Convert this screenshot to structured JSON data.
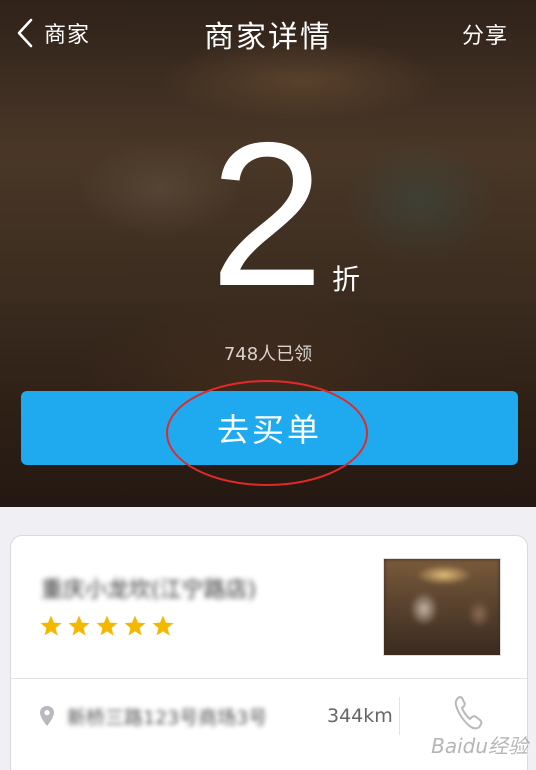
{
  "nav": {
    "back_label": "商家",
    "title": "商家详情",
    "share_label": "分享"
  },
  "offer": {
    "discount_value": "2",
    "discount_unit": "折",
    "claimed_text": "748人已领",
    "pay_button_label": "去买单"
  },
  "merchant": {
    "name": "重庆小龙坎(江宁路店)",
    "rating_stars": 5,
    "address": "新桥三路123号商场3号",
    "distance": "344km"
  },
  "watermark": "Baidu经验",
  "colors": {
    "pay_button": "#1faaf0",
    "star": "#f5b800",
    "highlight_circle": "#e02a2a"
  },
  "icons": [
    "chevron-left-icon",
    "star-icon",
    "location-pin-icon",
    "phone-icon"
  ]
}
